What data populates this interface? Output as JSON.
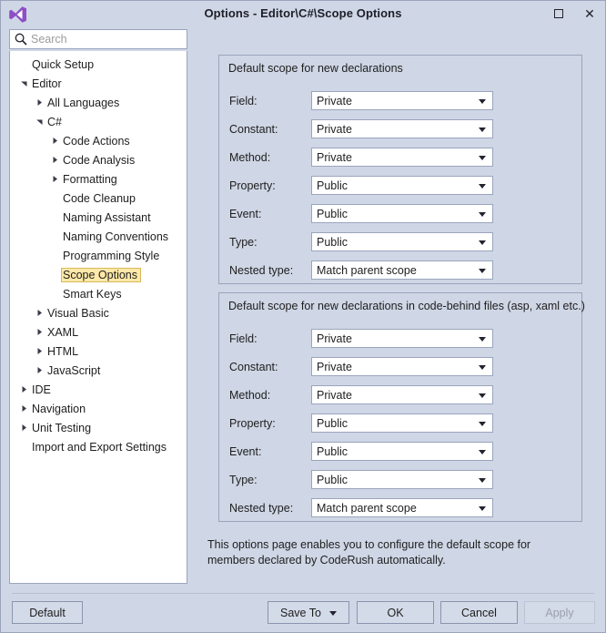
{
  "window": {
    "title": "Options - Editor\\C#\\Scope Options",
    "logo_icon": "visual-studio-logo-icon",
    "maximize_icon": "maximize-icon",
    "close_icon": "close-icon"
  },
  "search": {
    "placeholder": "Search",
    "value": "",
    "icon": "search-icon"
  },
  "tree": {
    "items": [
      {
        "label": "Quick Setup",
        "depth": 0,
        "arrow": "none"
      },
      {
        "label": "Editor",
        "depth": 0,
        "arrow": "expanded"
      },
      {
        "label": "All Languages",
        "depth": 1,
        "arrow": "collapsed"
      },
      {
        "label": "C#",
        "depth": 1,
        "arrow": "expanded"
      },
      {
        "label": "Code Actions",
        "depth": 2,
        "arrow": "collapsed"
      },
      {
        "label": "Code Analysis",
        "depth": 2,
        "arrow": "collapsed"
      },
      {
        "label": "Formatting",
        "depth": 2,
        "arrow": "collapsed"
      },
      {
        "label": "Code Cleanup",
        "depth": 2,
        "arrow": "none"
      },
      {
        "label": "Naming Assistant",
        "depth": 2,
        "arrow": "none"
      },
      {
        "label": "Naming Conventions",
        "depth": 2,
        "arrow": "none"
      },
      {
        "label": "Programming Style",
        "depth": 2,
        "arrow": "none"
      },
      {
        "label": "Scope Options",
        "depth": 2,
        "arrow": "none",
        "selected": true
      },
      {
        "label": "Smart Keys",
        "depth": 2,
        "arrow": "none"
      },
      {
        "label": "Visual Basic",
        "depth": 1,
        "arrow": "collapsed"
      },
      {
        "label": "XAML",
        "depth": 1,
        "arrow": "collapsed"
      },
      {
        "label": "HTML",
        "depth": 1,
        "arrow": "collapsed"
      },
      {
        "label": "JavaScript",
        "depth": 1,
        "arrow": "collapsed"
      },
      {
        "label": "IDE",
        "depth": 0,
        "arrow": "collapsed"
      },
      {
        "label": "Navigation",
        "depth": 0,
        "arrow": "collapsed"
      },
      {
        "label": "Unit Testing",
        "depth": 0,
        "arrow": "collapsed"
      },
      {
        "label": "Import and Export Settings",
        "depth": 0,
        "arrow": "none"
      }
    ]
  },
  "groups": [
    {
      "title": "Default scope for new declarations",
      "rows": [
        {
          "label": "Field:",
          "value": "Private"
        },
        {
          "label": "Constant:",
          "value": "Private"
        },
        {
          "label": "Method:",
          "value": "Private"
        },
        {
          "label": "Property:",
          "value": "Public"
        },
        {
          "label": "Event:",
          "value": "Public"
        },
        {
          "label": "Type:",
          "value": "Public"
        },
        {
          "label": "Nested type:",
          "value": "Match parent scope"
        }
      ]
    },
    {
      "title": "Default scope for new declarations in code-behind files (asp, xaml etc.)",
      "rows": [
        {
          "label": "Field:",
          "value": "Private"
        },
        {
          "label": "Constant:",
          "value": "Private"
        },
        {
          "label": "Method:",
          "value": "Private"
        },
        {
          "label": "Property:",
          "value": "Public"
        },
        {
          "label": "Event:",
          "value": "Public"
        },
        {
          "label": "Type:",
          "value": "Public"
        },
        {
          "label": "Nested type:",
          "value": "Match parent scope"
        }
      ]
    }
  ],
  "description": "This options page enables you to configure the default scope for members declared by CodeRush automatically.",
  "buttons": {
    "default": "Default",
    "save_to": "Save To",
    "ok": "OK",
    "cancel": "Cancel",
    "apply": "Apply"
  },
  "colors": {
    "window_bg": "#cfd6e5",
    "panel_bg": "#ffffff",
    "border": "#9aa5bd",
    "selection_bg": "#ffe9a8",
    "selection_border": "#d7b95c",
    "accent_logo": "#8e4ec6",
    "disabled_text": "#9aa0ac"
  }
}
